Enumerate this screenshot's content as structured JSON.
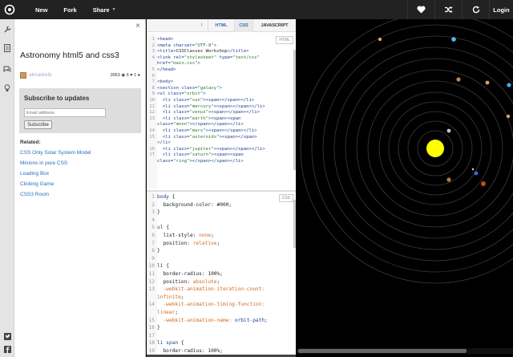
{
  "topbar": {
    "logo_icon": "codepen-logo-icon",
    "new_label": "New",
    "fork_label": "Fork",
    "share_label": "Share",
    "share_caret": "▼",
    "heart_icon": "heart-icon",
    "shuffle_icon": "shuffle-icon",
    "refresh_icon": "refresh-icon",
    "login_label": "Login"
  },
  "rail": {
    "icons": [
      "wrench-icon",
      "document-icon",
      "comments-icon",
      "lightbulb-icon"
    ]
  },
  "panel": {
    "close_label": "×",
    "title": "Astronomy html5 and css3",
    "author": "almadrebi",
    "views": "3963",
    "hearts": "6",
    "comments": "1",
    "subscribe_title": "Subscribe to updates",
    "email_placeholder": "Email address",
    "subscribe_button": "Subscribe",
    "related_heading": "Related:",
    "related": [
      "CSS Only Solar System Model",
      "Minions in pure CSS",
      "Loading Box",
      "Clicking Game",
      "CSS3 Room"
    ]
  },
  "social": [
    "twitter-icon",
    "facebook-icon",
    "google-plus-icon"
  ],
  "editor": {
    "tabs": {
      "collapse_icon": "↓",
      "html": "HTML",
      "css": "CSS",
      "js": "JAVASCRIPT"
    },
    "html_badge": "HTML",
    "css_badge": "CSS",
    "html_lines": [
      {
        "n": "1",
        "tokens": [
          [
            "t-tag",
            "<head>"
          ]
        ]
      },
      {
        "n": "2",
        "tokens": [
          [
            "t-tag",
            "<meta "
          ],
          [
            "t-attr",
            "charset="
          ],
          [
            "t-str",
            "\"UTF-8\""
          ],
          [
            "t-tag",
            ">"
          ]
        ]
      },
      {
        "n": "3",
        "tokens": [
          [
            "t-tag",
            "<title>"
          ],
          [
            "code",
            "CSSClasses Workshop"
          ],
          [
            "t-tag",
            "</title>"
          ]
        ]
      },
      {
        "n": "4",
        "tokens": [
          [
            "t-tag",
            "<link "
          ],
          [
            "t-attr",
            "rel="
          ],
          [
            "t-str",
            "\"stylesheet\""
          ],
          [
            "t-attr",
            " type="
          ],
          [
            "t-str",
            "\"text/css\""
          ]
        ]
      },
      {
        "n": "",
        "tokens": [
          [
            "t-attr",
            "href="
          ],
          [
            "t-str",
            "\"main.css\""
          ],
          [
            "t-tag",
            ">"
          ]
        ]
      },
      {
        "n": "5",
        "tokens": [
          [
            "t-tag",
            "</head>"
          ]
        ]
      },
      {
        "n": "6",
        "tokens": []
      },
      {
        "n": "7",
        "tokens": [
          [
            "t-tag",
            "<body>"
          ]
        ]
      },
      {
        "n": "8",
        "tokens": [
          [
            "t-tag",
            "<section "
          ],
          [
            "t-attr",
            "class="
          ],
          [
            "t-str",
            "\"galaxy\""
          ],
          [
            "t-tag",
            ">"
          ]
        ]
      },
      {
        "n": "9",
        "tokens": [
          [
            "t-tag",
            "<ul "
          ],
          [
            "t-attr",
            "class="
          ],
          [
            "t-str",
            "\"orbit\""
          ],
          [
            "t-tag",
            ">"
          ]
        ]
      },
      {
        "n": "10",
        "tokens": [
          [
            "t-tag",
            "  <li "
          ],
          [
            "t-attr",
            "class="
          ],
          [
            "t-str",
            "\"sun\""
          ],
          [
            "t-tag",
            "><span></span></li>"
          ]
        ]
      },
      {
        "n": "11",
        "tokens": [
          [
            "t-tag",
            "  <li "
          ],
          [
            "t-attr",
            "class="
          ],
          [
            "t-str",
            "\"mercury\""
          ],
          [
            "t-tag",
            "><span></span></li>"
          ]
        ]
      },
      {
        "n": "12",
        "tokens": [
          [
            "t-tag",
            "  <li "
          ],
          [
            "t-attr",
            "class="
          ],
          [
            "t-str",
            "\"venus\""
          ],
          [
            "t-tag",
            "><span></span></li>"
          ]
        ]
      },
      {
        "n": "13",
        "tokens": [
          [
            "t-tag",
            "  <li "
          ],
          [
            "t-attr",
            "class="
          ],
          [
            "t-str",
            "\"earth\""
          ],
          [
            "t-tag",
            "><span><span"
          ]
        ]
      },
      {
        "n": "",
        "tokens": [
          [
            "t-attr",
            "class="
          ],
          [
            "t-str",
            "\"moon\""
          ],
          [
            "t-tag",
            "></span></span></li>"
          ]
        ]
      },
      {
        "n": "14",
        "tokens": [
          [
            "t-tag",
            "  <li "
          ],
          [
            "t-attr",
            "class="
          ],
          [
            "t-str",
            "\"mars\""
          ],
          [
            "t-tag",
            "><span></span></li>"
          ]
        ]
      },
      {
        "n": "15",
        "tokens": [
          [
            "t-tag",
            "  <li "
          ],
          [
            "t-attr",
            "class="
          ],
          [
            "t-str",
            "\"asteroids\""
          ],
          [
            "t-tag",
            "><span></span>"
          ]
        ]
      },
      {
        "n": "",
        "tokens": [
          [
            "t-tag",
            "</li>"
          ]
        ]
      },
      {
        "n": "16",
        "tokens": [
          [
            "t-tag",
            "  <li "
          ],
          [
            "t-attr",
            "class="
          ],
          [
            "t-str",
            "\"jupiter\""
          ],
          [
            "t-tag",
            "><span></span></li>"
          ]
        ]
      },
      {
        "n": "17",
        "tokens": [
          [
            "t-tag",
            "  <li "
          ],
          [
            "t-attr",
            "class="
          ],
          [
            "t-str",
            "\"saturn\""
          ],
          [
            "t-tag",
            "><span><span"
          ]
        ]
      },
      {
        "n": "",
        "tokens": [
          [
            "t-attr",
            "class="
          ],
          [
            "t-str",
            "\"ring\""
          ],
          [
            "t-tag",
            "></span></span></li>"
          ]
        ]
      }
    ],
    "css_lines": [
      {
        "n": "1",
        "tokens": [
          [
            "t-sel",
            "body "
          ],
          [
            "t-punc",
            "{"
          ]
        ]
      },
      {
        "n": "2",
        "tokens": [
          [
            "t-prop",
            "  background-color: "
          ],
          [
            "t-punc",
            "#000;"
          ]
        ]
      },
      {
        "n": "3",
        "tokens": [
          [
            "t-punc",
            "}"
          ]
        ]
      },
      {
        "n": "4",
        "tokens": []
      },
      {
        "n": "5",
        "tokens": [
          [
            "t-sel",
            "ul "
          ],
          [
            "t-punc",
            "{"
          ]
        ]
      },
      {
        "n": "6",
        "tokens": [
          [
            "t-prop",
            "  list-style: "
          ],
          [
            "t-val",
            "none"
          ],
          [
            "t-punc",
            ";"
          ]
        ]
      },
      {
        "n": "7",
        "tokens": [
          [
            "t-prop",
            "  position: "
          ],
          [
            "t-val",
            "relative"
          ],
          [
            "t-punc",
            ";"
          ]
        ]
      },
      {
        "n": "8",
        "tokens": [
          [
            "t-punc",
            "}"
          ]
        ]
      },
      {
        "n": "9",
        "tokens": []
      },
      {
        "n": "10",
        "tokens": [
          [
            "t-sel",
            "li "
          ],
          [
            "t-punc",
            "{"
          ]
        ]
      },
      {
        "n": "11",
        "tokens": [
          [
            "t-prop",
            "  border-radius: "
          ],
          [
            "t-punc",
            "100%;"
          ]
        ]
      },
      {
        "n": "12",
        "tokens": [
          [
            "t-prop",
            "  position: "
          ],
          [
            "t-val",
            "absolute"
          ],
          [
            "t-punc",
            ";"
          ]
        ]
      },
      {
        "n": "13",
        "tokens": [
          [
            "t-val",
            "  -webkit-animation-iteration-count:"
          ]
        ]
      },
      {
        "n": "",
        "tokens": [
          [
            "t-val",
            "infinite"
          ],
          [
            "t-punc",
            ";"
          ]
        ]
      },
      {
        "n": "14",
        "tokens": [
          [
            "t-val",
            "  -webkit-animation-timing-function:"
          ]
        ]
      },
      {
        "n": "",
        "tokens": [
          [
            "t-val",
            "linear"
          ],
          [
            "t-punc",
            ";"
          ]
        ]
      },
      {
        "n": "15",
        "tokens": [
          [
            "t-val",
            "  -webkit-animation-name: "
          ],
          [
            "t-sel",
            "orbit-path"
          ],
          [
            "t-punc",
            ";"
          ]
        ]
      },
      {
        "n": "16",
        "tokens": [
          [
            "t-punc",
            "}"
          ]
        ]
      },
      {
        "n": "17",
        "tokens": []
      },
      {
        "n": "18",
        "tokens": [
          [
            "t-sel",
            "li span "
          ],
          [
            "t-punc",
            "{"
          ]
        ]
      },
      {
        "n": "19",
        "tokens": [
          [
            "t-prop",
            "  border-radius: "
          ],
          [
            "t-punc",
            "100%;"
          ]
        ]
      }
    ]
  },
  "stage": {
    "background": "#000000",
    "orbit_color": "#3a3a3a",
    "sun_color": "#ffff00",
    "bodies": [
      {
        "name": "planet-mercury",
        "color": "#c7c7c7"
      },
      {
        "name": "planet-venus-1",
        "color": "#c47b2b"
      },
      {
        "name": "planet-earth",
        "color": "#2b6ed2"
      },
      {
        "name": "moon",
        "color": "#dddddd"
      },
      {
        "name": "planet-mars",
        "color": "#c14a1b"
      },
      {
        "name": "planet-jupiter",
        "color": "#c9874a"
      },
      {
        "name": "planet-saturn",
        "color": "#d9a35a"
      },
      {
        "name": "planet-uranus",
        "color": "#5db7e8"
      },
      {
        "name": "planet-neptune",
        "color": "#4fa7e3"
      },
      {
        "name": "planet-outer",
        "color": "#d3a860"
      },
      {
        "name": "planet-small",
        "color": "#e0b070"
      }
    ]
  }
}
